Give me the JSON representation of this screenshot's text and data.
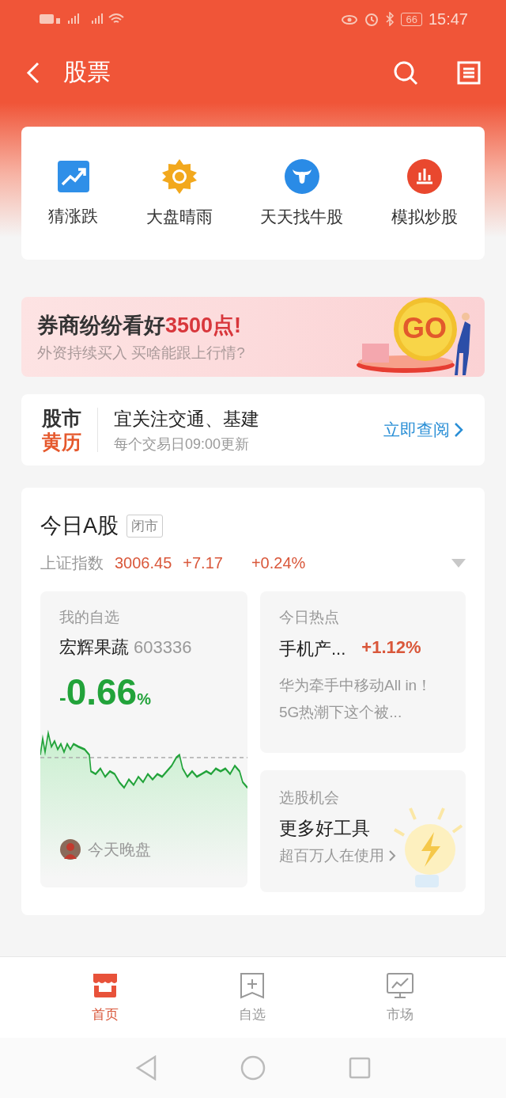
{
  "status_bar": {
    "time": "15:47",
    "battery": "66"
  },
  "header": {
    "title": "股票"
  },
  "shortcuts": [
    {
      "label": "猜涨跌",
      "kind": "trend"
    },
    {
      "label": "大盘晴雨",
      "kind": "sun"
    },
    {
      "label": "天天找牛股",
      "kind": "bull"
    },
    {
      "label": "模拟炒股",
      "kind": "bars"
    }
  ],
  "banner": {
    "title": "券商纷纷看好",
    "highlight": "3500点!",
    "subtitle": "外资持续买入  买啥能跟上行情?",
    "badge": "GO"
  },
  "calendar": {
    "logo_top": "股市",
    "logo_bottom": "黄历",
    "title": "宜关注交通、基建",
    "subtitle": "每个交易日09:00更新",
    "link": "立即查阅"
  },
  "market": {
    "title": "今日A股",
    "status": "闭市",
    "index_name": "上证指数",
    "value": "3006.45",
    "change": "+7.17",
    "percent": "+0.24%"
  },
  "watchlist": {
    "label": "我的自选",
    "name": "宏辉果蔬",
    "code": "603336",
    "sign": "-",
    "change": "0.66",
    "unit": "%",
    "color": "#22a33a",
    "footer": "今天晚盘"
  },
  "hot": {
    "label": "今日热点",
    "name": "手机产...",
    "change": "+1.12%",
    "color": "#d9573a",
    "text": "华为牵手中移动All in！5G热潮下这个被..."
  },
  "tools": {
    "label": "选股机会",
    "title": "更多好工具",
    "subtitle": "超百万人在使用"
  },
  "nav": [
    {
      "label": "首页",
      "kind": "home",
      "selected": true
    },
    {
      "label": "自选",
      "kind": "watch",
      "selected": false
    },
    {
      "label": "市场",
      "kind": "market",
      "selected": false
    }
  ]
}
